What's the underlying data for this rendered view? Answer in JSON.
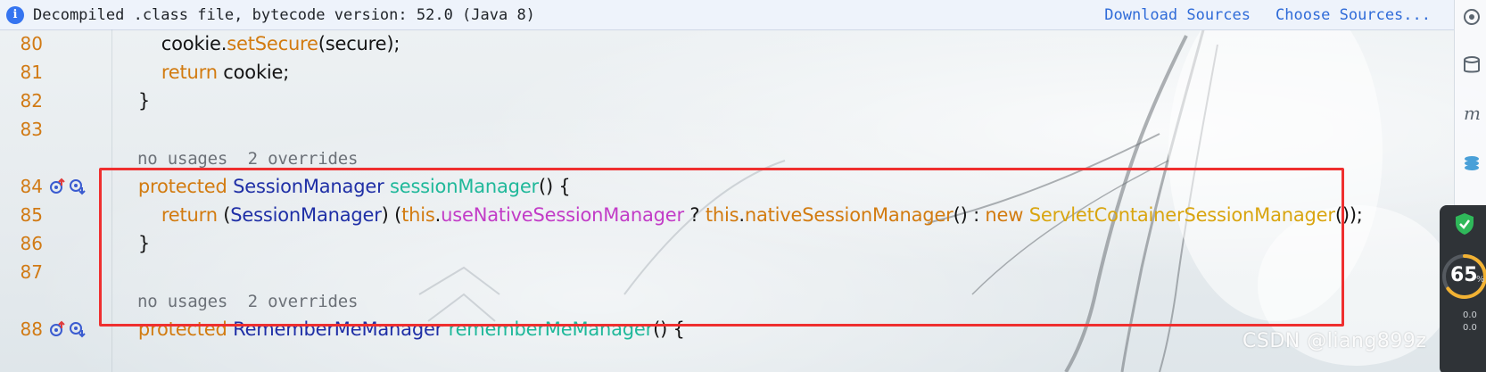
{
  "banner": {
    "message": "Decompiled .class file, bytecode version: 52.0 (Java 8)",
    "download_sources": "Download Sources",
    "choose_sources": "Choose Sources..."
  },
  "editor": {
    "lines": [
      {
        "num": "80",
        "tokens": [
          {
            "t": "        cookie.",
            "c": "pl"
          },
          {
            "t": "setSecure",
            "c": "kw"
          },
          {
            "t": "(secure);",
            "c": "pl"
          }
        ]
      },
      {
        "num": "81",
        "tokens": [
          {
            "t": "        ",
            "c": "pl"
          },
          {
            "t": "return",
            "c": "kw"
          },
          {
            "t": " cookie;",
            "c": "pl"
          }
        ]
      },
      {
        "num": "82",
        "tokens": [
          {
            "t": "    }",
            "c": "pl"
          }
        ]
      },
      {
        "num": "83",
        "tokens": []
      },
      {
        "hint": "no usages  2 overrides"
      },
      {
        "num": "84",
        "icons": true,
        "tokens": [
          {
            "t": "    ",
            "c": "pl"
          },
          {
            "t": "protected",
            "c": "kw"
          },
          {
            "t": " ",
            "c": "pl"
          },
          {
            "t": "SessionManager",
            "c": "ty"
          },
          {
            "t": " ",
            "c": "pl"
          },
          {
            "t": "sessionManager",
            "c": "fn"
          },
          {
            "t": "() {",
            "c": "pl"
          }
        ]
      },
      {
        "num": "85",
        "tokens": [
          {
            "t": "        ",
            "c": "pl"
          },
          {
            "t": "return",
            "c": "kw"
          },
          {
            "t": " (",
            "c": "pl"
          },
          {
            "t": "SessionManager",
            "c": "ty"
          },
          {
            "t": ") (",
            "c": "pl"
          },
          {
            "t": "this",
            "c": "kw"
          },
          {
            "t": ".",
            "c": "pl"
          },
          {
            "t": "useNativeSessionManager",
            "c": "mf"
          },
          {
            "t": " ? ",
            "c": "pl"
          },
          {
            "t": "this",
            "c": "kw"
          },
          {
            "t": ".",
            "c": "pl"
          },
          {
            "t": "nativeSessionManager",
            "c": "kw"
          },
          {
            "t": "() : ",
            "c": "pl"
          },
          {
            "t": "new",
            "c": "kw"
          },
          {
            "t": " ",
            "c": "pl"
          },
          {
            "t": "ServletContainerSessionManager",
            "c": "ca"
          },
          {
            "t": "());",
            "c": "pl"
          }
        ]
      },
      {
        "num": "86",
        "tokens": [
          {
            "t": "    }",
            "c": "pl"
          }
        ]
      },
      {
        "num": "87",
        "tokens": []
      },
      {
        "hint": "no usages  2 overrides"
      },
      {
        "num": "88",
        "icons": true,
        "tokens": [
          {
            "t": "    ",
            "c": "pl"
          },
          {
            "t": "protected",
            "c": "kw"
          },
          {
            "t": " ",
            "c": "pl"
          },
          {
            "t": "RememberMeManager",
            "c": "ty"
          },
          {
            "t": " ",
            "c": "pl"
          },
          {
            "t": "rememberMeManager",
            "c": "fn"
          },
          {
            "t": "() {",
            "c": "pl"
          }
        ]
      }
    ]
  },
  "right_toolbar": {
    "icons": [
      "notifications-icon",
      "database-icon",
      "maven-icon",
      "database-stack-icon"
    ]
  },
  "monitor_widget": {
    "percent": "65",
    "unit": "%",
    "net_up": "0.0",
    "net_down": "0.0"
  },
  "watermark": "CSDN @liang899z"
}
